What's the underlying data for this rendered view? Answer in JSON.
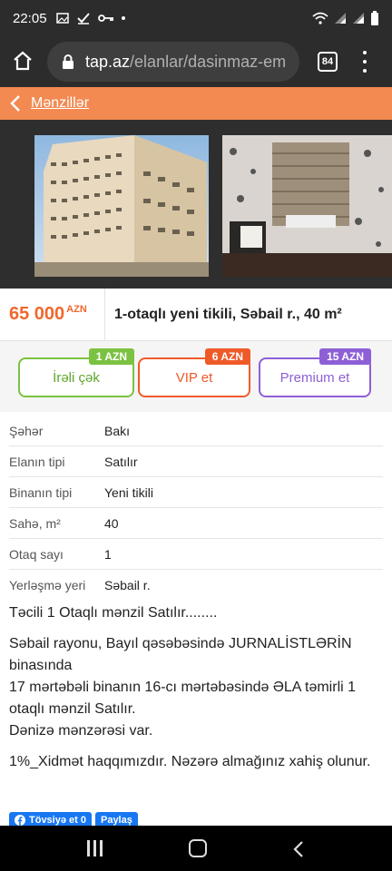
{
  "status": {
    "time": "22:05"
  },
  "browser": {
    "url_host": "tap.az",
    "url_path": "/elanlar/dasinmaz-em",
    "tab_count": "84"
  },
  "nav": {
    "back_label": "Mənzillər"
  },
  "listing": {
    "price": "65 000",
    "currency": "AZN",
    "title": "1-otaqlı yeni tikili, Səbail r., 40 m²"
  },
  "promo": [
    {
      "label": "İrəli çək",
      "badge": "1 AZN",
      "color": "#7cc242"
    },
    {
      "label": "VIP et",
      "badge": "6 AZN",
      "color": "#ef5a29"
    },
    {
      "label": "Premium et",
      "badge": "15 AZN",
      "color": "#8e5fd6"
    }
  ],
  "properties": [
    {
      "key": "Şəhər",
      "value": "Bakı"
    },
    {
      "key": "Elanın tipi",
      "value": "Satılır"
    },
    {
      "key": "Binanın tipi",
      "value": "Yeni tikili"
    },
    {
      "key": "Sahə, m²",
      "value": "40"
    },
    {
      "key": "Otaq sayı",
      "value": "1"
    },
    {
      "key": "Yerləşmə yeri",
      "value": "Səbail r."
    }
  ],
  "description": {
    "p1": "Təcili 1 Otaqlı mənzil Satılır........",
    "p2a": "Səbail rayonu, Bayıl qəsəbəsində JURNALİSTLƏRİN binasında",
    "p2b": "17 mərtəbəli binanın 16-cı mərtəbəsində ƏLA təmirli 1 otaqlı mənzil Satılır.",
    "p2c": "Dənizə mənzərəsi var.",
    "p3": "1%_Xidmət haqqımızdır. Nəzərə almağınız xahiş olunur."
  },
  "social": {
    "recommend": "Tövsiyə et 0",
    "share": "Paylaş"
  }
}
